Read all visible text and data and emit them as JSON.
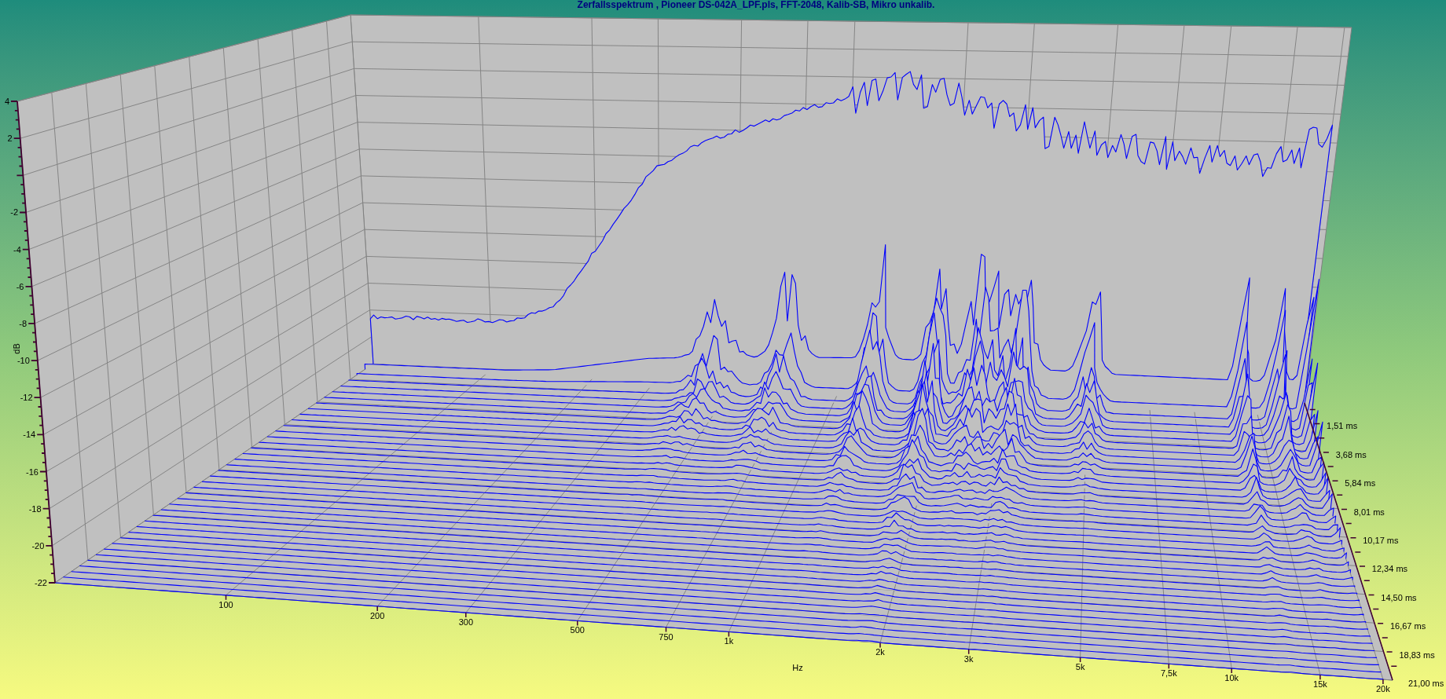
{
  "title": "Zerfallsspektrum , Pioneer DS-042A_LPF.pls, FFT-2048, Kalib-SB, Mikro unkalib.",
  "y_axis": {
    "label": "dB",
    "ticks": [
      "4",
      "2",
      "-2",
      "-4",
      "-6",
      "-8",
      "-10",
      "-12",
      "-14",
      "-16",
      "-18",
      "-20",
      "-22"
    ]
  },
  "x_axis": {
    "label": "Hz",
    "ticks": [
      "100",
      "200",
      "300",
      "500",
      "750",
      "1k",
      "2k",
      "3k",
      "5k",
      "7,5k",
      "10k",
      "15k",
      "20k"
    ]
  },
  "time_axis": {
    "ticks": [
      "1,51 ms",
      "3,68 ms",
      "5,84 ms",
      "8,01 ms",
      "10,17 ms",
      "12,34 ms",
      "14,50 ms",
      "16,67 ms",
      "18,83 ms",
      "21,00 ms"
    ]
  }
}
